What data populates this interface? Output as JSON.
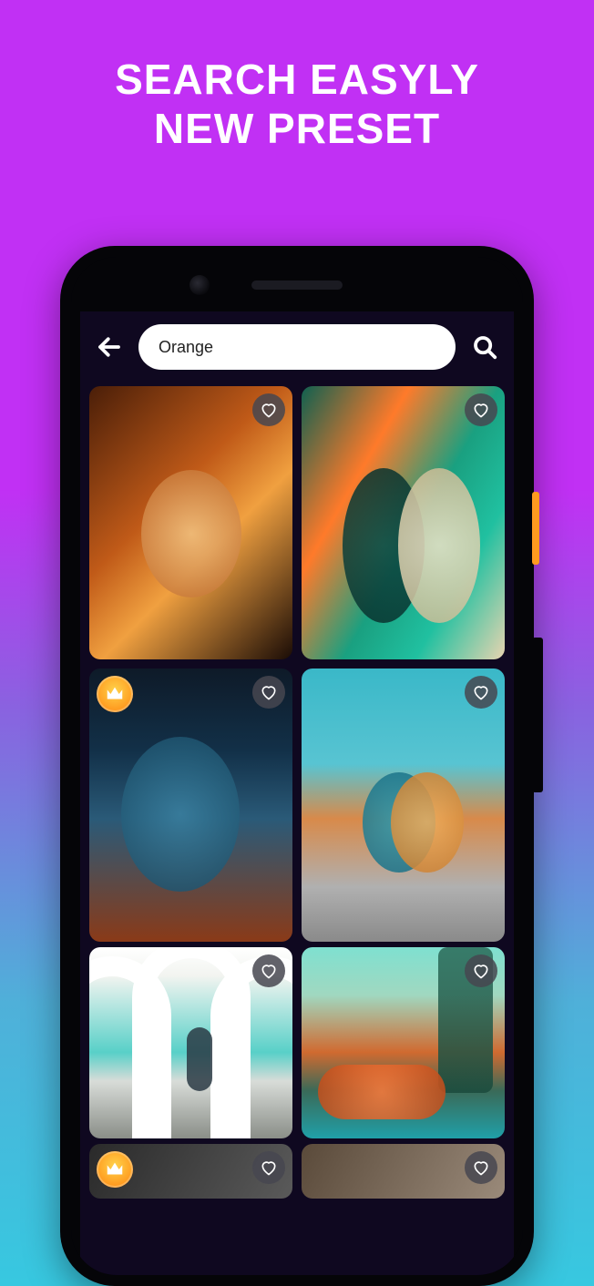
{
  "marketing": {
    "headline_line1": "SEARCH EASYLY",
    "headline_line2": "NEW PRESET"
  },
  "colors": {
    "gradient_top": "#c130f4",
    "gradient_bottom": "#37c8e0",
    "app_bg": "#0f0820",
    "premium_badge": "#ff9a1f"
  },
  "app": {
    "search": {
      "value": "Orange"
    },
    "icons": {
      "back": "back-arrow",
      "search": "magnifier",
      "favorite": "heart-outline",
      "premium": "crown"
    },
    "grid": {
      "columns": 2,
      "items": [
        {
          "id": "preset-1",
          "premium": false,
          "favorited": false
        },
        {
          "id": "preset-2",
          "premium": false,
          "favorited": false
        },
        {
          "id": "preset-3",
          "premium": true,
          "favorited": false
        },
        {
          "id": "preset-4",
          "premium": false,
          "favorited": false
        },
        {
          "id": "preset-5",
          "premium": false,
          "favorited": false
        },
        {
          "id": "preset-6",
          "premium": false,
          "favorited": false
        },
        {
          "id": "preset-7",
          "premium": true,
          "favorited": false
        },
        {
          "id": "preset-8",
          "premium": false,
          "favorited": false
        }
      ]
    }
  }
}
